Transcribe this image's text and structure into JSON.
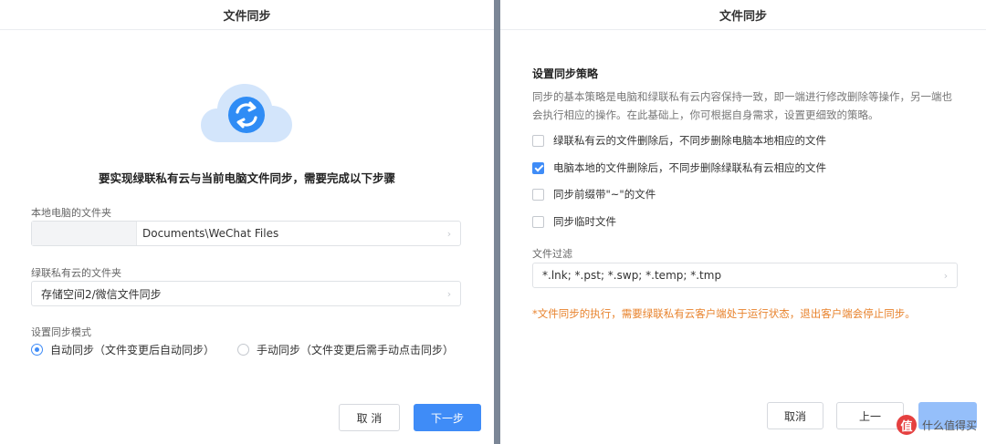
{
  "left": {
    "title": "文件同步",
    "step_title": "要实现绿联私有云与当前电脑文件同步，需要完成以下步骤",
    "local_folder": {
      "label": "本地电脑的文件夹",
      "value": "Documents\\WeChat Files"
    },
    "cloud_folder": {
      "label": "绿联私有云的文件夹",
      "value": "存储空间2/微信文件同步"
    },
    "sync_mode": {
      "label": "设置同步模式",
      "options": [
        {
          "label": "自动同步（文件变更后自动同步）",
          "selected": true
        },
        {
          "label": "手动同步（文件变更后需手动点击同步）",
          "selected": false
        }
      ]
    },
    "buttons": {
      "cancel": "取 消",
      "next": "下一步"
    }
  },
  "right": {
    "title": "文件同步",
    "section_title": "设置同步策略",
    "description": "同步的基本策略是电脑和绿联私有云内容保持一致，即一端进行修改删除等操作，另一端也会执行相应的操作。在此基础上，你可根据自身需求，设置更细致的策略。",
    "options": [
      {
        "label": "绿联私有云的文件删除后，不同步删除电脑本地相应的文件",
        "checked": false
      },
      {
        "label": "电脑本地的文件删除后，不同步删除绿联私有云相应的文件",
        "checked": true
      },
      {
        "label": "同步前缀带\"~\"的文件",
        "checked": false
      },
      {
        "label": "同步临时文件",
        "checked": false
      }
    ],
    "filter": {
      "label": "文件过滤",
      "value": "*.lnk; *.pst; *.swp; *.temp; *.tmp"
    },
    "warning": "*文件同步的执行，需要绿联私有云客户端处于运行状态，退出客户端会停止同步。",
    "buttons": {
      "cancel": "取消",
      "prev": "上一"
    },
    "watermark": {
      "badge": "值",
      "text": "什么值得买"
    }
  },
  "colors": {
    "primary": "#3f8cf7",
    "warning": "#e8832d",
    "cloud": "#cfe3fb",
    "sync_icon": "#2f8cf5"
  },
  "icons": [
    "cloud-sync-icon",
    "chevron-right-icon"
  ]
}
